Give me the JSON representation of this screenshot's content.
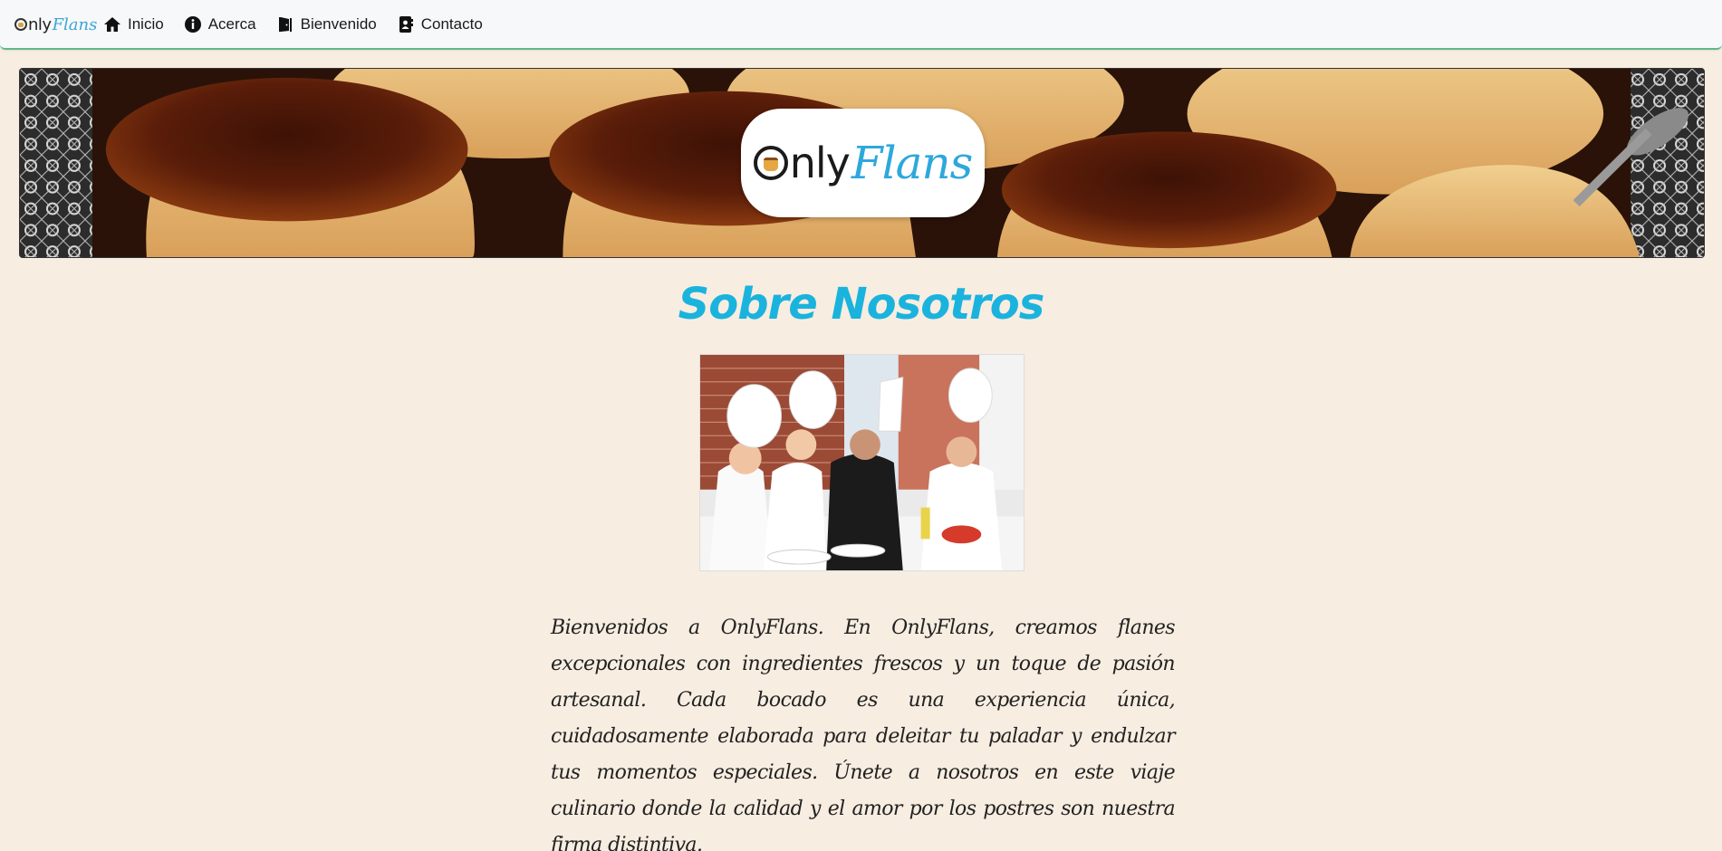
{
  "navbar": {
    "brand": {
      "only": "nly",
      "flans": "Flans"
    },
    "items": [
      {
        "label": "Inicio",
        "icon": "home-icon"
      },
      {
        "label": "Acerca",
        "icon": "info-icon"
      },
      {
        "label": "Bienvenido",
        "icon": "door-icon"
      },
      {
        "label": "Contacto",
        "icon": "contact-book-icon"
      }
    ]
  },
  "banner": {
    "logo": {
      "only": "nly",
      "flans": "Flans"
    }
  },
  "main": {
    "title": "Sobre Nosotros",
    "paragraph": "Bienvenidos a OnlyFlans. En OnlyFlans, creamos flanes excepcionales con ingredientes frescos y un toque de pasión artesanal. Cada bocado es una experiencia única, cuidadosamente elaborada para deleitar tu paladar y endulzar tus momentos especiales. Únete a nosotros en este viaje culinario donde la calidad y el amor por los postres son nuestra firma distintiva."
  },
  "colors": {
    "page_bg": "#f7ede1",
    "title": "#1ab3dd",
    "navbar_border": "#5fb88a"
  }
}
